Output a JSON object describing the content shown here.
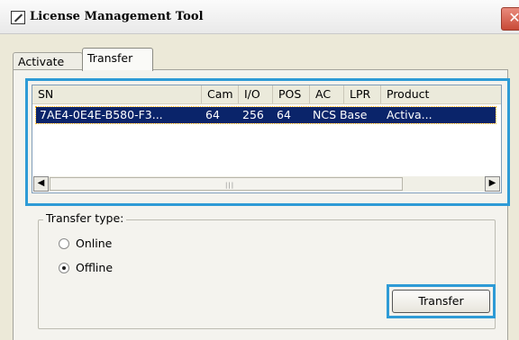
{
  "window": {
    "title": "License Management Tool",
    "close_glyph": "✕"
  },
  "tabs": [
    {
      "label": "Activate",
      "selected": false
    },
    {
      "label": "Transfer",
      "selected": true
    }
  ],
  "list": {
    "columns": [
      "SN",
      "Cam",
      "I/O",
      "POS",
      "AC",
      "LPR",
      "Product"
    ],
    "rows": [
      {
        "cells": [
          "7AE4-0E4E-B580-F3...",
          "64",
          "256",
          "64",
          "NCS Base",
          "",
          "Activa..."
        ],
        "selected": true
      }
    ]
  },
  "scrollbar": {
    "left_glyph": "◀",
    "right_glyph": "▶",
    "grip": "|||"
  },
  "transfer_type": {
    "label": "Transfer type:",
    "options": [
      {
        "label": "Online",
        "checked": false
      },
      {
        "label": "Offline",
        "checked": true
      }
    ]
  },
  "transfer_button": {
    "label": "Transfer"
  },
  "colors": {
    "highlight": "#2e9bd6",
    "selection": "#0a246a"
  }
}
